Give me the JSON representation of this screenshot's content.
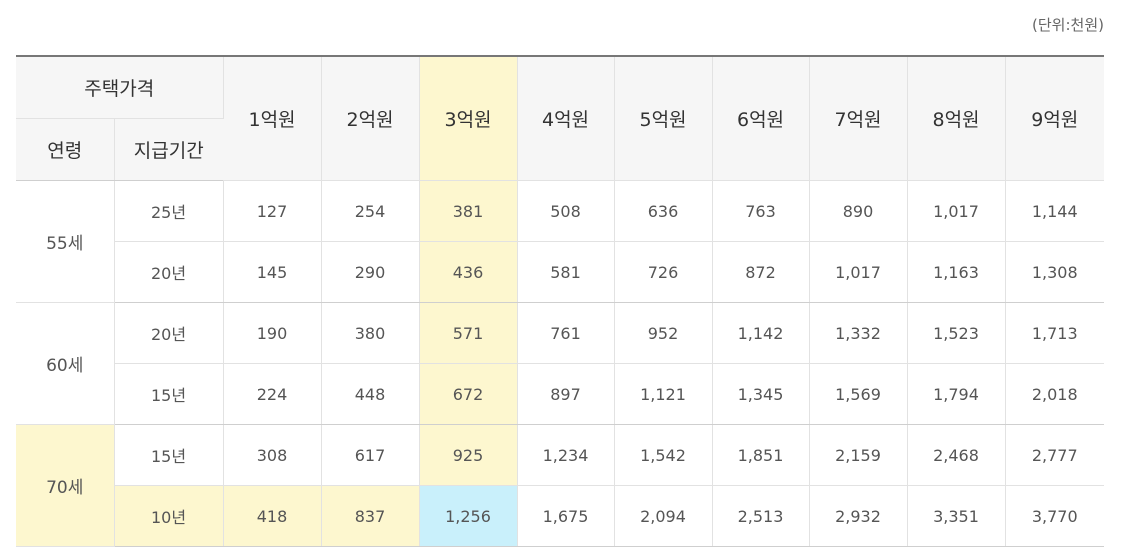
{
  "unit_label": "(단위:천원)",
  "header": {
    "house_price": "주택가격",
    "age": "연령",
    "period": "지급기간",
    "prices": [
      "1억원",
      "2억원",
      "3억원",
      "4억원",
      "5억원",
      "6억원",
      "7억원",
      "8억원",
      "9억원"
    ]
  },
  "groups": [
    {
      "age": "55세",
      "rows": [
        {
          "period": "25년",
          "values": [
            "127",
            "254",
            "381",
            "508",
            "636",
            "763",
            "890",
            "1,017",
            "1,144"
          ]
        },
        {
          "period": "20년",
          "values": [
            "145",
            "290",
            "436",
            "581",
            "726",
            "872",
            "1,017",
            "1,163",
            "1,308"
          ]
        }
      ]
    },
    {
      "age": "60세",
      "rows": [
        {
          "period": "20년",
          "values": [
            "190",
            "380",
            "571",
            "761",
            "952",
            "1,142",
            "1,332",
            "1,523",
            "1,713"
          ]
        },
        {
          "period": "15년",
          "values": [
            "224",
            "448",
            "672",
            "897",
            "1,121",
            "1,345",
            "1,569",
            "1,794",
            "2,018"
          ]
        }
      ]
    },
    {
      "age": "70세",
      "rows": [
        {
          "period": "15년",
          "values": [
            "308",
            "617",
            "925",
            "1,234",
            "1,542",
            "1,851",
            "2,159",
            "2,468",
            "2,777"
          ]
        },
        {
          "period": "10년",
          "values": [
            "418",
            "837",
            "1,256",
            "1,675",
            "2,094",
            "2,513",
            "2,932",
            "3,351",
            "3,770"
          ]
        }
      ]
    }
  ],
  "colors": {
    "highlight_yellow": "#fdf7cf",
    "highlight_blue": "#c9f0fb",
    "header_bg": "#f6f6f6"
  }
}
